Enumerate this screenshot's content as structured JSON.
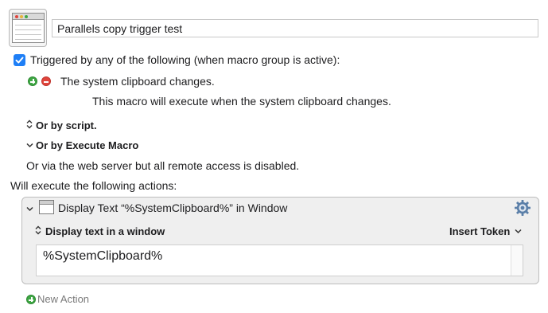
{
  "macro": {
    "name": "Parallels copy trigger test",
    "icon": "macro-window-icon"
  },
  "triggers": {
    "header": "Triggered by any of the following (when macro group is active):",
    "checked": true,
    "items": [
      {
        "label": "The system clipboard changes.",
        "description": "This macro will execute when the system clipboard changes."
      }
    ],
    "or_by_script": "Or by script.",
    "or_by_execute_macro": "Or by Execute Macro",
    "web_server_note": "Or via the web server but all remote access is disabled."
  },
  "actions": {
    "header": "Will execute the following actions:",
    "items": [
      {
        "title": "Display Text “%SystemClipboard%” in Window",
        "mode": "Display text in a window",
        "insert_token": "Insert Token",
        "text": "%SystemClipboard%"
      }
    ],
    "new_action": "New Action"
  },
  "colors": {
    "accent": "#1f7ff6",
    "add_green": "#3fa744",
    "remove_red": "#e0443c"
  }
}
